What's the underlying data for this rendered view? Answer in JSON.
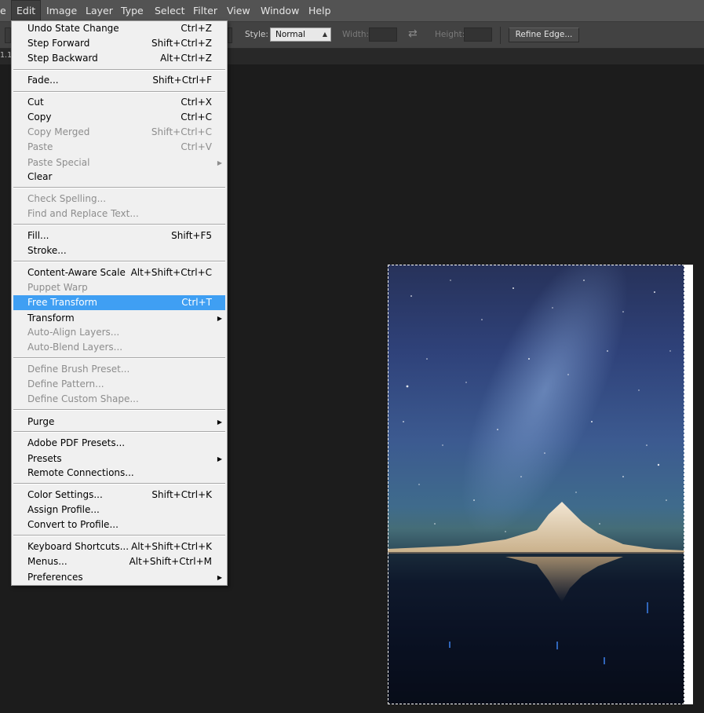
{
  "menubar": {
    "items": [
      {
        "label": "e"
      },
      {
        "label": "Edit"
      },
      {
        "label": "Image"
      },
      {
        "label": "Layer"
      },
      {
        "label": "Type"
      },
      {
        "label": "Select"
      },
      {
        "label": "Filter"
      },
      {
        "label": "View"
      },
      {
        "label": "Window"
      },
      {
        "label": "Help"
      }
    ]
  },
  "options": {
    "style_label": "Style:",
    "style_value": "Normal",
    "width_label": "Width:",
    "height_label": "Height:",
    "refine_button": "Refine Edge...",
    "swap_glyph": "⇄"
  },
  "tabstrip": {
    "fragment": "1.1"
  },
  "edit_menu": {
    "items": [
      {
        "label": "Undo State Change",
        "shortcut": "Ctrl+Z"
      },
      {
        "label": "Step Forward",
        "shortcut": "Shift+Ctrl+Z"
      },
      {
        "label": "Step Backward",
        "shortcut": "Alt+Ctrl+Z"
      },
      {
        "label": "Fade...",
        "shortcut": "Shift+Ctrl+F"
      },
      {
        "label": "Cut",
        "shortcut": "Ctrl+X"
      },
      {
        "label": "Copy",
        "shortcut": "Ctrl+C"
      },
      {
        "label": "Copy Merged",
        "shortcut": "Shift+Ctrl+C"
      },
      {
        "label": "Paste",
        "shortcut": "Ctrl+V"
      },
      {
        "label": "Paste Special",
        "shortcut": ""
      },
      {
        "label": "Clear",
        "shortcut": ""
      },
      {
        "label": "Check Spelling...",
        "shortcut": ""
      },
      {
        "label": "Find and Replace Text...",
        "shortcut": ""
      },
      {
        "label": "Fill...",
        "shortcut": "Shift+F5"
      },
      {
        "label": "Stroke...",
        "shortcut": ""
      },
      {
        "label": "Content-Aware Scale",
        "shortcut": "Alt+Shift+Ctrl+C"
      },
      {
        "label": "Puppet Warp",
        "shortcut": ""
      },
      {
        "label": "Free Transform",
        "shortcut": "Ctrl+T"
      },
      {
        "label": "Transform",
        "shortcut": ""
      },
      {
        "label": "Auto-Align Layers...",
        "shortcut": ""
      },
      {
        "label": "Auto-Blend Layers...",
        "shortcut": ""
      },
      {
        "label": "Define Brush Preset...",
        "shortcut": ""
      },
      {
        "label": "Define Pattern...",
        "shortcut": ""
      },
      {
        "label": "Define Custom Shape...",
        "shortcut": ""
      },
      {
        "label": "Purge",
        "shortcut": ""
      },
      {
        "label": "Adobe PDF Presets...",
        "shortcut": ""
      },
      {
        "label": "Presets",
        "shortcut": ""
      },
      {
        "label": "Remote Connections...",
        "shortcut": ""
      },
      {
        "label": "Color Settings...",
        "shortcut": "Shift+Ctrl+K"
      },
      {
        "label": "Assign Profile...",
        "shortcut": ""
      },
      {
        "label": "Convert to Profile...",
        "shortcut": ""
      },
      {
        "label": "Keyboard Shortcuts...",
        "shortcut": "Alt+Shift+Ctrl+K"
      },
      {
        "label": "Menus...",
        "shortcut": "Alt+Shift+Ctrl+M"
      },
      {
        "label": "Preferences",
        "shortcut": ""
      }
    ],
    "submenu_glyph": "▶"
  },
  "colors": {
    "highlight": "#3f9ff3",
    "menu_bg": "#f0f0f0",
    "app_bg": "#1c1c1c"
  }
}
